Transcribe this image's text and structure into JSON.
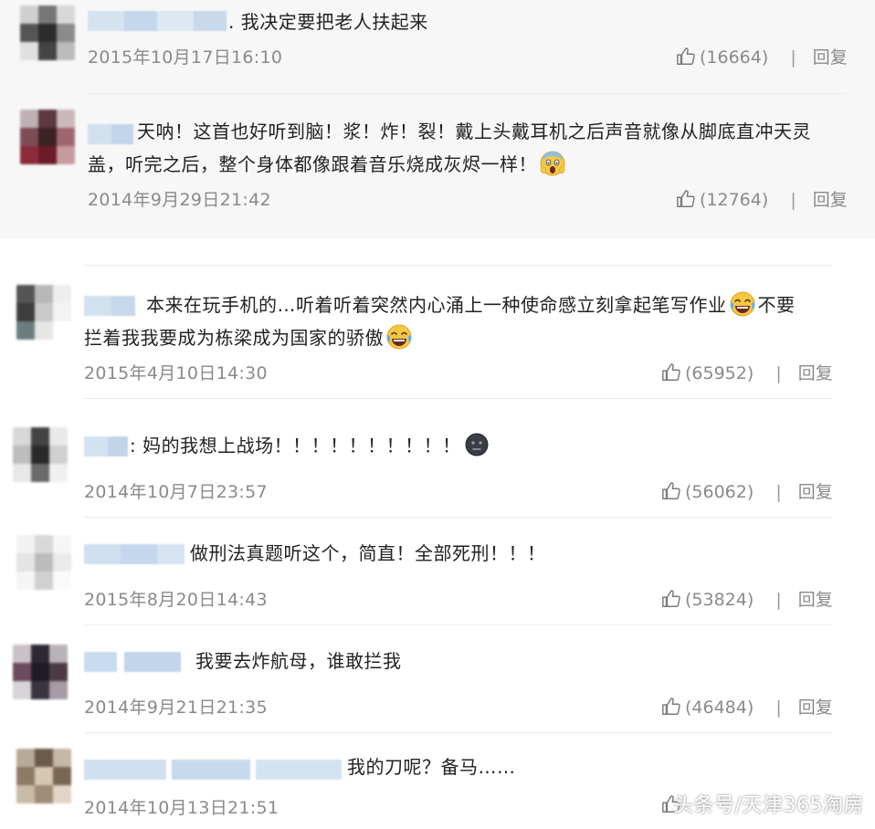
{
  "reply_label": "回复",
  "comments": [
    {
      "text_lines": [
        "我决定要把老人扶起来"
      ],
      "time": "2015年10月17日16:10",
      "likes": "(16664)"
    },
    {
      "text_lines": [
        "天呐！这首也好听到脑！浆！炸！裂！戴上头戴耳机之后声音就像从脚底直冲天灵",
        "盖，听完之后，整个身体都像跟着音乐烧成灰烬一样！"
      ],
      "time": "2014年9月29日21:42",
      "likes": "(12764)"
    },
    {
      "text_lines": [
        "本来在玩手机的…听着听着突然内心涌上一种使命感立刻拿起笔写作业",
        "不要",
        "拦着我我要成为栋梁成为国家的骄傲"
      ],
      "time": "2015年4月10日14:30",
      "likes": "(65952)"
    },
    {
      "text_lines": [
        ": 妈的我想上战场！！！！！！！！！！"
      ],
      "time": "2014年10月7日23:57",
      "likes": "(56062)"
    },
    {
      "text_lines": [
        "做刑法真题听这个，简直！全部死刑！！！"
      ],
      "time": "2015年8月20日14:43",
      "likes": "(53824)"
    },
    {
      "text_lines": [
        "我要去炸航母，谁敢拦我"
      ],
      "time": "2014年9月21日21:35",
      "likes": "(46484)"
    },
    {
      "text_lines": [
        "我的刀呢？备马……"
      ],
      "time": "2014年10月13日21:51",
      "likes": ""
    }
  ],
  "watermark": "头条号/天津365淘房",
  "emojis": {
    "scream": "scream-emoji",
    "laugh_cry": "laugh-cry-emoji",
    "dark_face": "dark-face-emoji"
  }
}
